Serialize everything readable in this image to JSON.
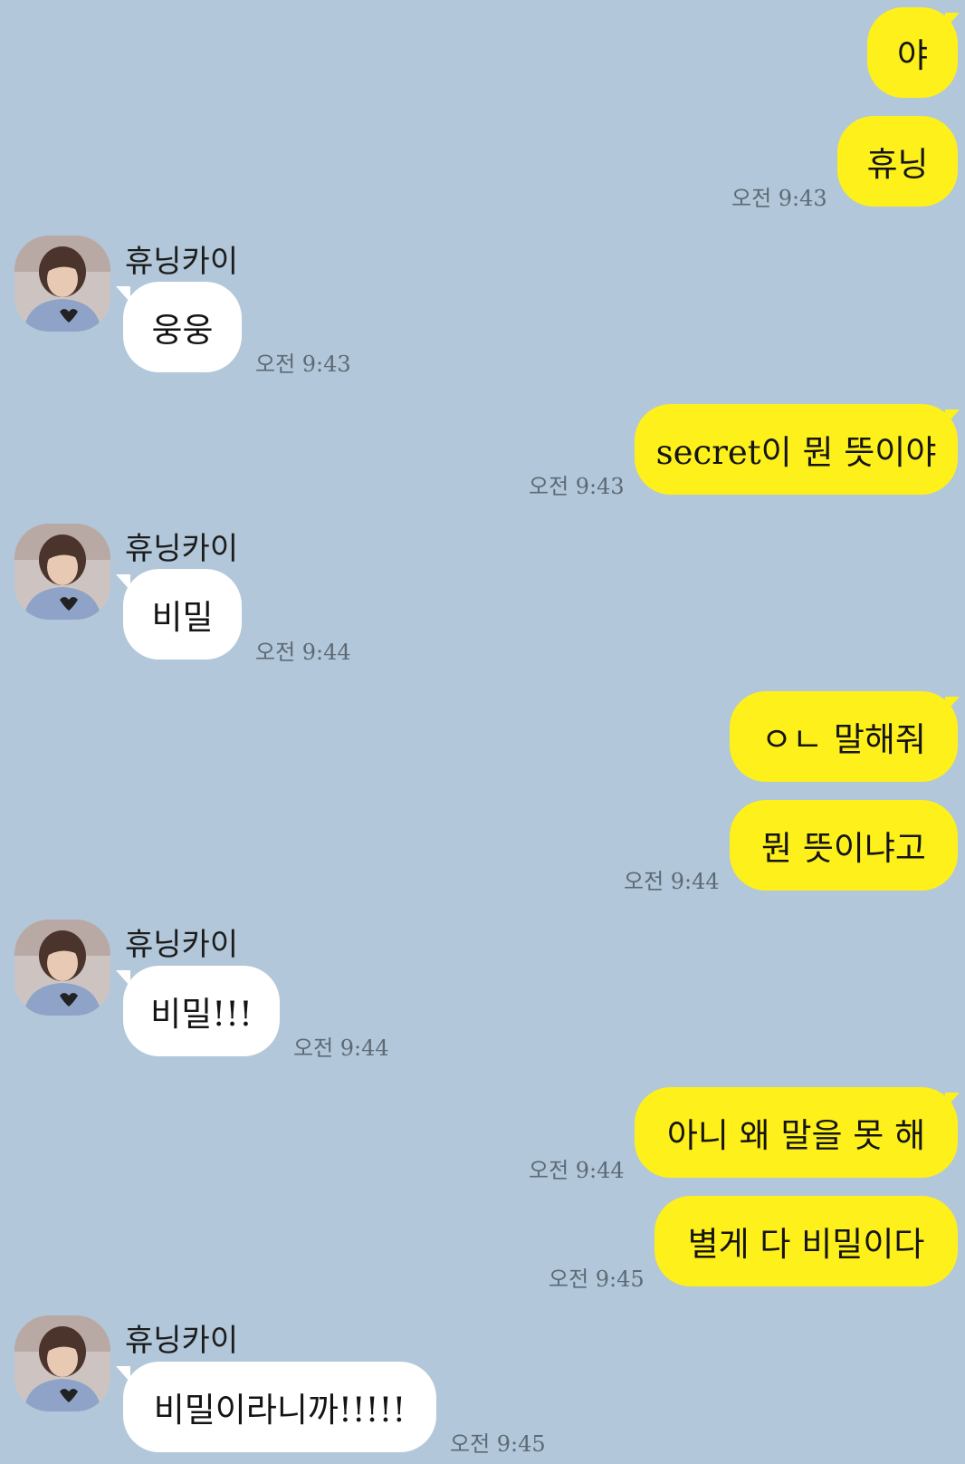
{
  "chat": {
    "messages": [
      {
        "from": "me",
        "text": "야"
      },
      {
        "from": "me",
        "text": "휴닝",
        "time": "오전 9:43"
      },
      {
        "from": "them",
        "sender": "휴닝카이",
        "text": "웅웅",
        "time": "오전 9:43"
      },
      {
        "from": "me",
        "text": "secret이 뭔 뜻이야",
        "time": "오전 9:43"
      },
      {
        "from": "them",
        "sender": "휴닝카이",
        "text": "비밀",
        "time": "오전 9:44"
      },
      {
        "from": "me",
        "text": "ㅇㄴ 말해줘"
      },
      {
        "from": "me",
        "text": "뭔 뜻이냐고",
        "time": "오전 9:44"
      },
      {
        "from": "them",
        "sender": "휴닝카이",
        "text": "비밀!!!",
        "time": "오전 9:44"
      },
      {
        "from": "me",
        "text": "아니 왜 말을 못 해",
        "time": "오전 9:44"
      },
      {
        "from": "me",
        "text": "별게 다 비밀이다",
        "time": "오전 9:45"
      },
      {
        "from": "them",
        "sender": "휴닝카이",
        "text": "비밀이라니까!!!!!",
        "time": "오전 9:45"
      }
    ]
  },
  "colors": {
    "background": "#b2c7d9",
    "my_bubble": "#fef01b",
    "their_bubble": "#ffffff",
    "timestamp": "#5d6a75"
  },
  "icons": {
    "avatar": "profile-photo-icon"
  }
}
